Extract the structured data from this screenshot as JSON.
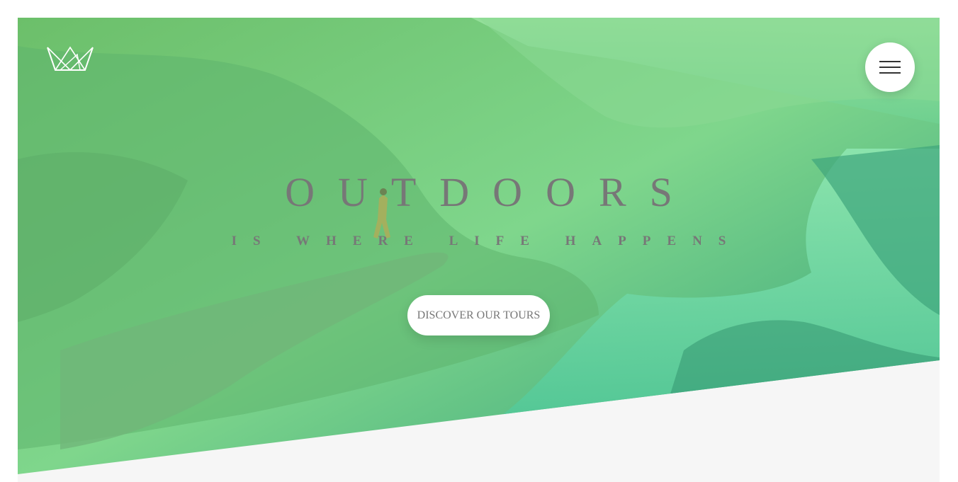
{
  "hero": {
    "title": "OUTDOORS",
    "subtitle": "IS WHERE LIFE HAPPENS",
    "cta_label": "DISCOVER OUR TOURS"
  },
  "header": {
    "logo_icon": "crown-logo-icon",
    "menu_icon": "hamburger-menu-icon"
  },
  "colors": {
    "gradient_light": "#7ed56f",
    "gradient_dark": "#28b485",
    "page_background": "#f6f6f6",
    "heading_text": "#777777",
    "button_background": "#ffffff"
  }
}
